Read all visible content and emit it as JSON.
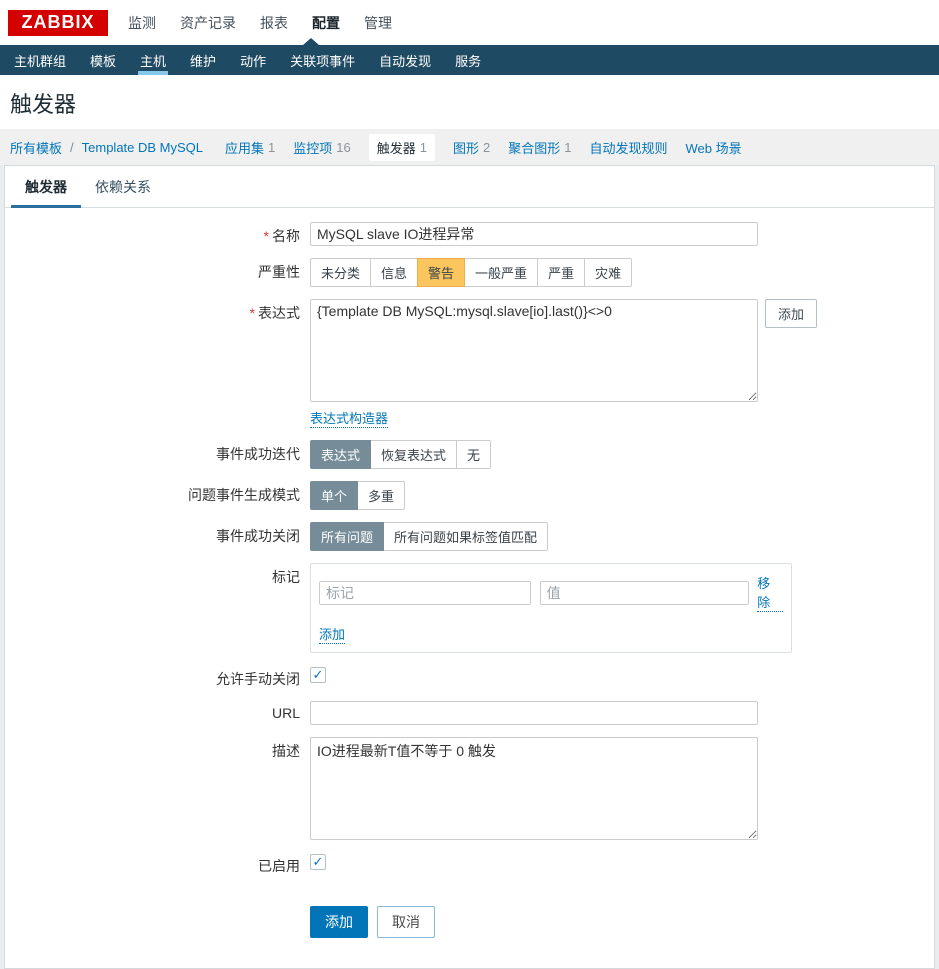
{
  "header": {
    "logo": "ZABBIX",
    "menu": [
      {
        "label": "监测",
        "active": false
      },
      {
        "label": "资产记录",
        "active": false
      },
      {
        "label": "报表",
        "active": false
      },
      {
        "label": "配置",
        "active": true
      },
      {
        "label": "管理",
        "active": false
      }
    ]
  },
  "nav": {
    "items": [
      {
        "label": "主机群组",
        "active": false
      },
      {
        "label": "模板",
        "active": false
      },
      {
        "label": "主机",
        "active": true
      },
      {
        "label": "维护",
        "active": false
      },
      {
        "label": "动作",
        "active": false
      },
      {
        "label": "关联项事件",
        "active": false
      },
      {
        "label": "自动发现",
        "active": false
      },
      {
        "label": "服务",
        "active": false
      }
    ]
  },
  "page": {
    "title": "触发器"
  },
  "breadcrumb": {
    "root_link": "所有模板",
    "separator": "/",
    "template_link": "Template DB MySQL",
    "tabs": [
      {
        "label": "应用集",
        "count": "1",
        "active": false
      },
      {
        "label": "监控项",
        "count": "16",
        "active": false
      },
      {
        "label": "触发器",
        "count": "1",
        "active": true
      },
      {
        "label": "图形",
        "count": "2",
        "active": false
      },
      {
        "label": "聚合图形",
        "count": "1",
        "active": false
      },
      {
        "label": "自动发现规则",
        "count": "",
        "active": false
      },
      {
        "label": "Web 场景",
        "count": "",
        "active": false
      }
    ]
  },
  "form_tabs": [
    {
      "label": "触发器",
      "active": true
    },
    {
      "label": "依赖关系",
      "active": false
    }
  ],
  "form": {
    "required_mark": "*",
    "name": {
      "label": "名称",
      "value": "MySQL slave IO进程异常"
    },
    "severity": {
      "label": "严重性",
      "options": [
        "未分类",
        "信息",
        "警告",
        "一般严重",
        "严重",
        "灾难"
      ],
      "selected": "警告"
    },
    "expression": {
      "label": "表达式",
      "value": "{Template DB MySQL:mysql.slave[io].last()}<>0",
      "add_button": "添加",
      "constructor_link": "表达式构造器"
    },
    "ok_event_generation": {
      "label": "事件成功迭代",
      "options": [
        "表达式",
        "恢复表达式",
        "无"
      ],
      "selected": "表达式"
    },
    "problem_event_mode": {
      "label": "问题事件生成模式",
      "options": [
        "单个",
        "多重"
      ],
      "selected": "单个"
    },
    "ok_event_closes": {
      "label": "事件成功关闭",
      "options": [
        "所有问题",
        "所有问题如果标签值匹配"
      ],
      "selected": "所有问题"
    },
    "tags": {
      "label": "标记",
      "tag_placeholder": "标记",
      "value_placeholder": "值",
      "remove_link": "移除",
      "add_link": "添加"
    },
    "manual_close": {
      "label": "允许手动关闭",
      "checked": true,
      "check_glyph": "✓"
    },
    "url": {
      "label": "URL",
      "value": ""
    },
    "description": {
      "label": "描述",
      "value": "IO进程最新T值不等于 0 触发"
    },
    "enabled": {
      "label": "已启用",
      "checked": true,
      "check_glyph": "✓"
    },
    "actions": {
      "add": "添加",
      "cancel": "取消"
    }
  },
  "colors": {
    "logo_red": "#d40000",
    "nav_bg": "#1f4a63",
    "nav_active_underline": "#87c7e8",
    "link_blue": "#0275b8",
    "severity_selected_orange": "#fcc55e",
    "segmented_selected_gray": "#768d99",
    "primary_button": "#0275b8"
  }
}
